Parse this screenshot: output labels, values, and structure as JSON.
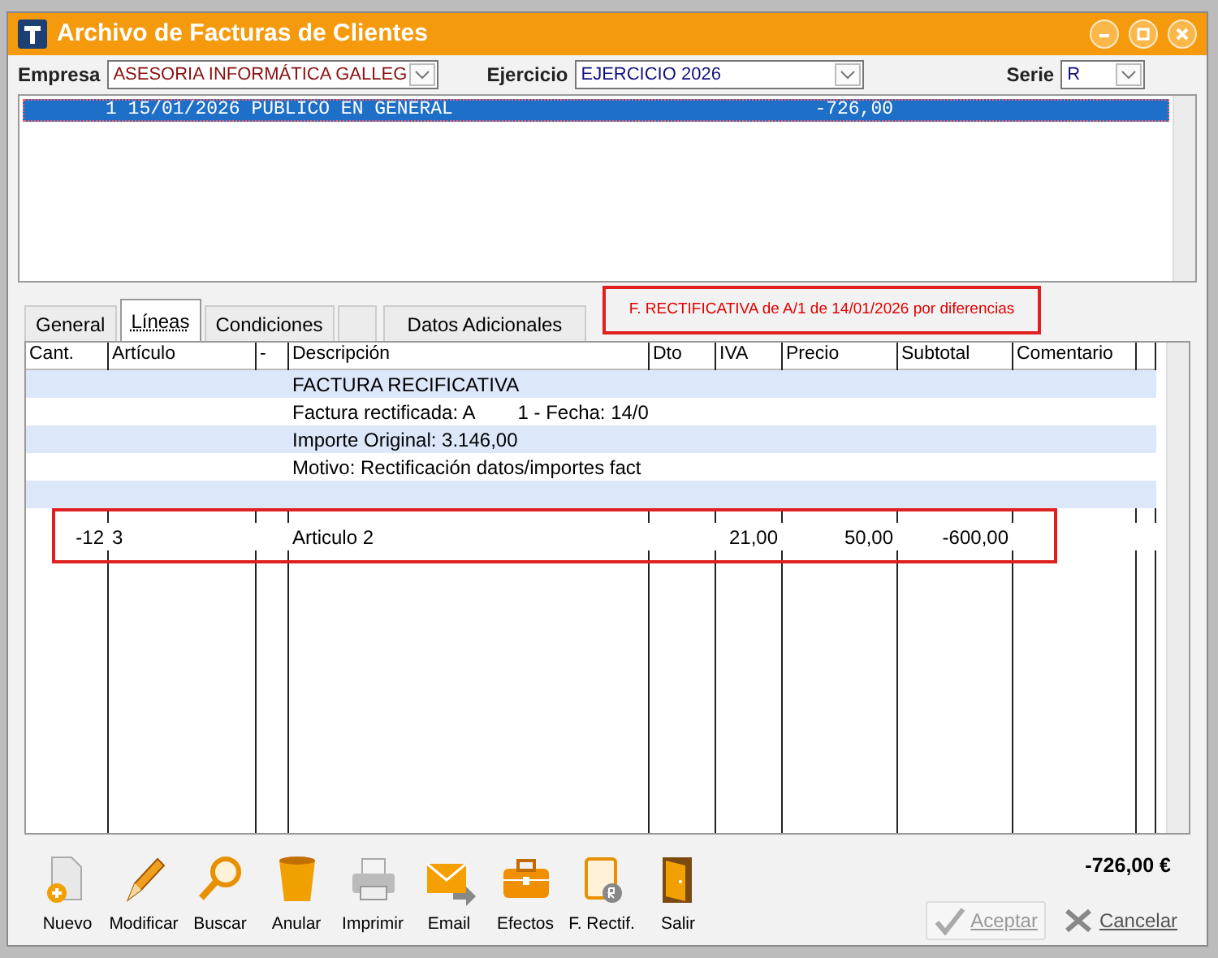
{
  "window": {
    "title": "Archivo de Facturas de Clientes"
  },
  "filters": [
    {
      "label": "Empresa",
      "value": "ASESORIA INFORMÁTICA GALLEG",
      "kind": "red"
    },
    {
      "label": "Ejercicio",
      "value": "EJERCICIO 2026",
      "kind": "blue"
    },
    {
      "label": "Serie",
      "value": "R",
      "kind": "blue"
    }
  ],
  "invoice_list": [
    {
      "text": "1 15/01/2026 PUBLICO EN GENERAL",
      "amount": "-726,00",
      "selected": true
    }
  ],
  "tabs": [
    {
      "label": "General",
      "selected": false
    },
    {
      "label": "Líneas",
      "selected": true
    },
    {
      "label": "Condiciones",
      "selected": false
    },
    {
      "label": "Datos Adicionales",
      "selected": false
    }
  ],
  "note": {
    "text": "F. RECTIFICATIVA de A/1 de 14/01/2026 por diferencias",
    "highlighted": true
  },
  "table": {
    "columns": [
      "Cant.",
      "Artículo",
      "-",
      "Descripción",
      "Dto",
      "IVA",
      "Precio",
      "Subtotal",
      "Comentario"
    ],
    "rows": [
      {
        "cells": [
          "",
          "",
          "",
          "FACTURA RECIFICATIVA",
          "",
          "",
          "",
          "",
          ""
        ],
        "highlighted": false
      },
      {
        "cells": [
          "",
          "",
          "",
          "Factura rectificada: A        1 - Fecha: 14/0",
          "",
          "",
          "",
          "",
          ""
        ],
        "highlighted": false
      },
      {
        "cells": [
          "",
          "",
          "",
          "Importe Original: 3.146,00",
          "",
          "",
          "",
          "",
          ""
        ],
        "highlighted": false
      },
      {
        "cells": [
          "",
          "",
          "",
          "Motivo: Rectificación datos/importes fact",
          "",
          "",
          "",
          "",
          ""
        ],
        "highlighted": false
      },
      {
        "cells": [
          "",
          "",
          "",
          "",
          "",
          "",
          "",
          "",
          ""
        ],
        "highlighted": false
      },
      {
        "cells": [
          "-12",
          "3",
          "",
          "Articulo 2",
          "",
          "21,00",
          "50,00",
          "-600,00",
          ""
        ],
        "highlighted": true
      }
    ]
  },
  "toolbar": [
    {
      "label": "Nuevo",
      "kind": "new"
    },
    {
      "label": "Modificar",
      "kind": "edit"
    },
    {
      "label": "Buscar",
      "kind": "search"
    },
    {
      "label": "Anular",
      "kind": "cancel"
    },
    {
      "label": "Imprimir",
      "kind": "print"
    },
    {
      "label": "Email",
      "kind": "email"
    },
    {
      "label": "Efectos",
      "kind": "effects"
    },
    {
      "label": "F. Rectif.",
      "kind": "rectif"
    },
    {
      "label": "Salir",
      "kind": "exit"
    }
  ],
  "total": "-726,00 €",
  "buttons": [
    {
      "label": "Aceptar",
      "kind": "accept",
      "disabled": true
    },
    {
      "label": "Cancelar",
      "kind": "cancel",
      "disabled": false
    }
  ]
}
